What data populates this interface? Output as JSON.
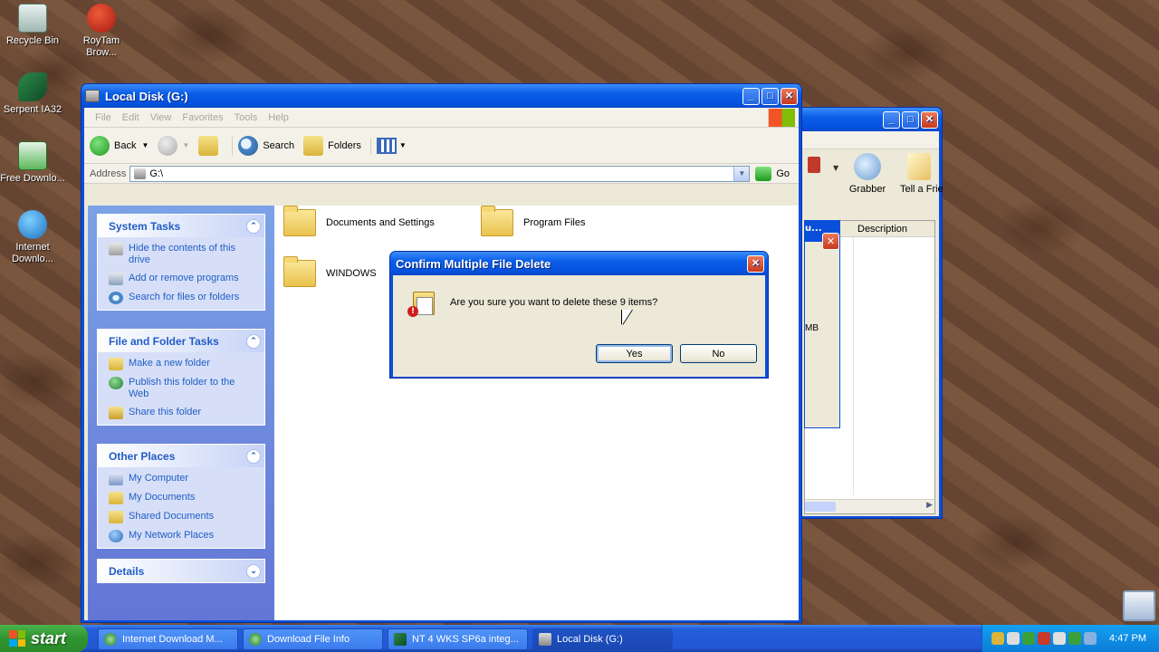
{
  "desktop": {
    "icons": [
      {
        "label": "Recycle Bin"
      },
      {
        "label": "RoyTam Brow..."
      },
      {
        "label": "Serpent IA32"
      },
      {
        "label": "Free Downlo..."
      },
      {
        "label": "Internet Downlo..."
      }
    ]
  },
  "back_window": {
    "toolbar": {
      "grabber_label": "Grabber",
      "tell_label": "Tell a Frie"
    },
    "column_header": "Description",
    "size_fragment": "MB",
    "app_fragment": "u..."
  },
  "explorer": {
    "title": "Local Disk (G:)",
    "menu": [
      "File",
      "Edit",
      "View",
      "Favorites",
      "Tools",
      "Help"
    ],
    "toolbar": {
      "back_label": "Back",
      "search_label": "Search",
      "folders_label": "Folders"
    },
    "address": {
      "label": "Address",
      "value": "G:\\",
      "go_label": "Go"
    },
    "sidebar": {
      "system_tasks": {
        "title": "System Tasks",
        "items": [
          "Hide the contents of this drive",
          "Add or remove programs",
          "Search for files or folders"
        ]
      },
      "file_folder_tasks": {
        "title": "File and Folder Tasks",
        "items": [
          "Make a new folder",
          "Publish this folder to the Web",
          "Share this folder"
        ]
      },
      "other_places": {
        "title": "Other Places",
        "items": [
          "My Computer",
          "My Documents",
          "Shared Documents",
          "My Network Places"
        ]
      },
      "details": {
        "title": "Details"
      }
    },
    "folders": [
      "Documents and Settings",
      "Program Files",
      "WINDOWS"
    ]
  },
  "dialog": {
    "title": "Confirm Multiple File Delete",
    "message": "Are you sure you want to delete these 9 items?",
    "yes_label": "Yes",
    "no_label": "No"
  },
  "taskbar": {
    "start_label": "start",
    "tasks": [
      "Internet Download M...",
      "Download File Info",
      "NT 4 WKS SP6a integ...",
      "Local Disk (G:)"
    ],
    "clock": "4:47 PM"
  },
  "colors": {
    "xp_blue": "#0a4fd9",
    "link_blue": "#215dc6",
    "task_pane": "#d6dff7"
  }
}
